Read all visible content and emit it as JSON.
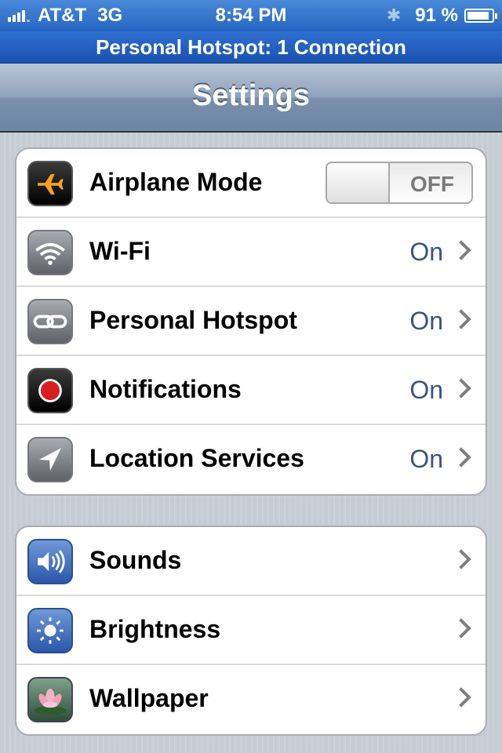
{
  "status_bar": {
    "carrier": "AT&T",
    "network": "3G",
    "time": "8:54 PM",
    "battery_percent": "91 %",
    "battery_level": 0.91,
    "bluetooth_icon": "bluetooth-icon"
  },
  "hotspot_banner": "Personal Hotspot: 1 Connection",
  "nav": {
    "title": "Settings"
  },
  "group1": [
    {
      "label": "Airplane Mode",
      "icon": "airplane-icon",
      "toggle": "OFF"
    },
    {
      "label": "Wi-Fi",
      "icon": "wifi-icon",
      "value": "On"
    },
    {
      "label": "Personal Hotspot",
      "icon": "hotspot-link-icon",
      "value": "On"
    },
    {
      "label": "Notifications",
      "icon": "notifications-icon",
      "value": "On"
    },
    {
      "label": "Location Services",
      "icon": "location-arrow-icon",
      "value": "On"
    }
  ],
  "group2": [
    {
      "label": "Sounds",
      "icon": "speaker-icon"
    },
    {
      "label": "Brightness",
      "icon": "sun-icon"
    },
    {
      "label": "Wallpaper",
      "icon": "flower-icon"
    }
  ],
  "colors": {
    "status_bar": "#2f6fd0",
    "value_text": "#385487",
    "nav_bar": "#7a90ac"
  }
}
